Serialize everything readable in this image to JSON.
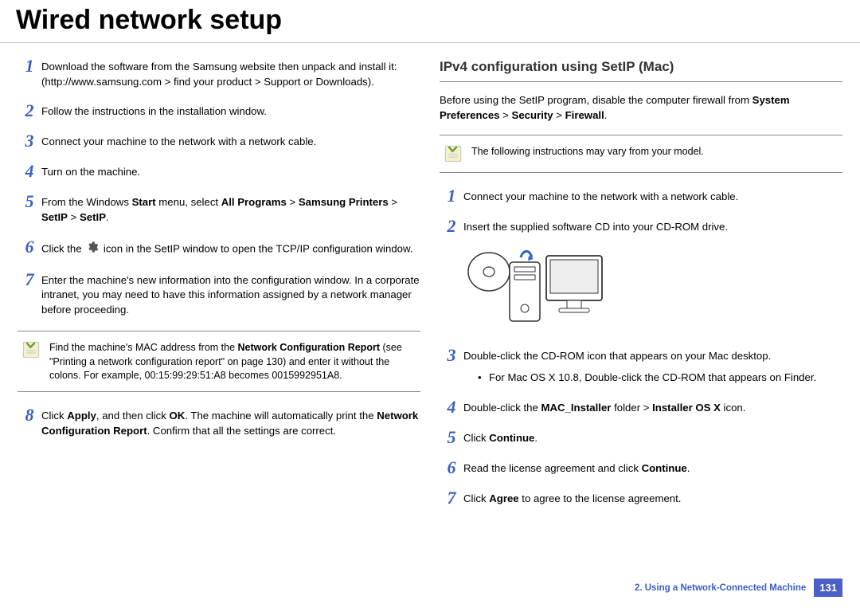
{
  "page_title": "Wired network setup",
  "left": {
    "steps": {
      "s1": "Download the software from the Samsung website then unpack and install it: (http://www.samsung.com > find your product > Support or Downloads).",
      "s2": "Follow the instructions in the installation window.",
      "s3": "Connect your machine to the network with a network cable.",
      "s4": "Turn on the machine.",
      "s5_pre": "From the Windows ",
      "s5_bold1": "Start",
      "s5_mid": " menu, select ",
      "s5_bold2": "All Programs",
      "s5_gt1": " > ",
      "s5_bold3": "Samsung Printers",
      "s5_gt2": " > ",
      "s5_bold4": "SetIP",
      "s5_gt3": " > ",
      "s5_bold5": "SetIP",
      "s5_end": ".",
      "s6_pre": "Click the ",
      "s6_post": " icon in the SetIP window to open the TCP/IP configuration window.",
      "s7": "Enter the machine's new information into the configuration window. In a corporate intranet, you may need to have this information assigned by a network manager before proceeding.",
      "s8_pre": "Click ",
      "s8_b1": "Apply",
      "s8_mid1": ", and then click ",
      "s8_b2": "OK",
      "s8_mid2": ". The machine will automatically print the ",
      "s8_b3": "Network Configuration Report",
      "s8_end": ". Confirm that all the settings are correct."
    },
    "note": {
      "pre": "Find the machine's MAC address from the ",
      "bold": "Network Configuration Report",
      "post": " (see \"Printing a network configuration report\" on page 130) and enter it without the colons. For example, 00:15:99:29:51:A8 becomes 0015992951A8."
    }
  },
  "right": {
    "title": "IPv4 configuration using SetIP (Mac)",
    "intro_pre": "Before using the SetIP program, disable the computer firewall from ",
    "intro_b1": "System Preferences",
    "intro_gt1": " > ",
    "intro_b2": "Security",
    "intro_gt2": " > ",
    "intro_b3": "Firewall",
    "intro_end": ".",
    "note": "The following instructions may vary from your model.",
    "steps": {
      "s1": "Connect your machine to the network with a network cable.",
      "s2": "Insert the supplied software CD into your CD-ROM drive.",
      "s3": "Double-click the CD-ROM icon that appears on your Mac desktop.",
      "s3_sub": "For Mac OS X 10.8, Double-click the CD-ROM that appears on Finder.",
      "s4_pre": "Double-click the ",
      "s4_b1": "MAC_Installer",
      "s4_mid": " folder > ",
      "s4_b2": "Installer OS X",
      "s4_end": " icon.",
      "s5_pre": "Click ",
      "s5_b": "Continue",
      "s5_end": ".",
      "s6_pre": "Read the license agreement and click ",
      "s6_b": "Continue",
      "s6_end": ".",
      "s7_pre": "Click ",
      "s7_b": "Agree",
      "s7_end": " to agree to the license agreement."
    }
  },
  "footer": {
    "chapter": "2.  Using a Network-Connected Machine",
    "page": "131"
  },
  "numbers": {
    "n1": "1",
    "n2": "2",
    "n3": "3",
    "n4": "4",
    "n5": "5",
    "n6": "6",
    "n7": "7",
    "n8": "8"
  }
}
